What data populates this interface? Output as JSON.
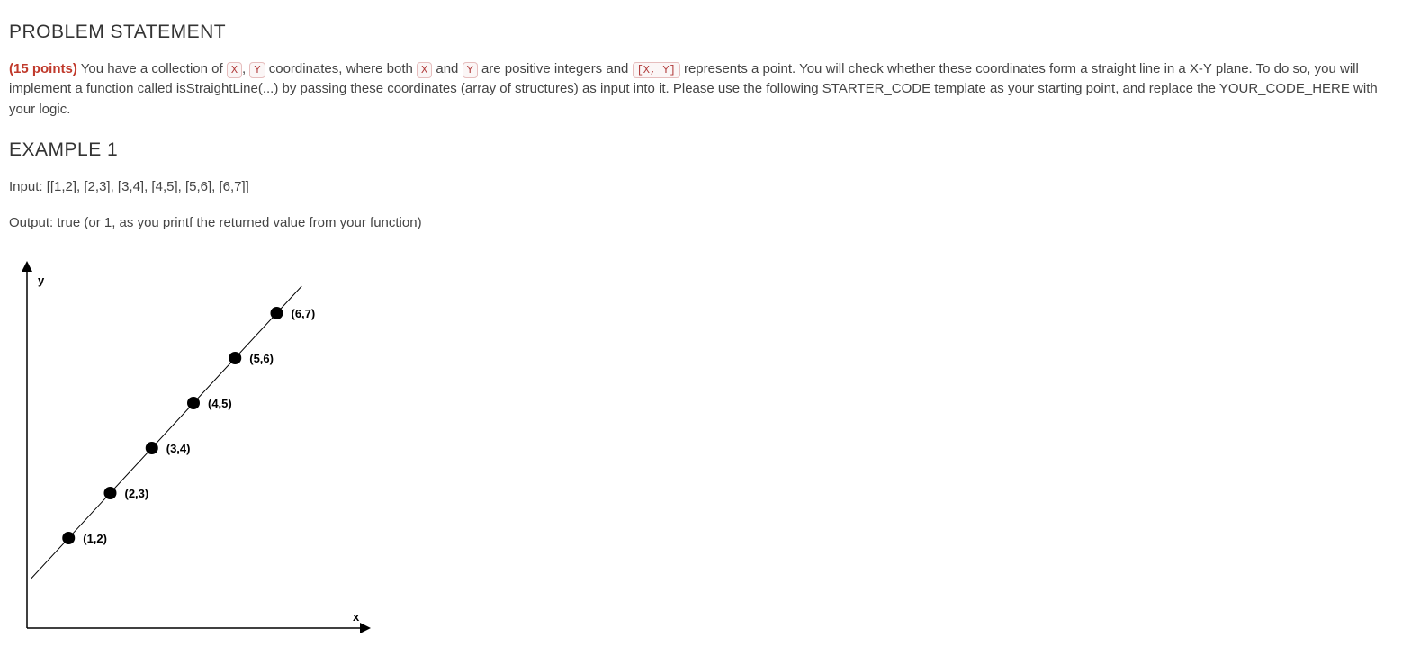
{
  "headings": {
    "problem": "PROBLEM STATEMENT",
    "example1": "EXAMPLE 1"
  },
  "problem": {
    "points_label": "(15 points)",
    "seg1": " You have a collection of ",
    "tok_x": "X",
    "seg2": ", ",
    "tok_y": "Y",
    "seg3": " coordinates, where both ",
    "tok_x2": "X",
    "seg4": " and ",
    "tok_y2": "Y",
    "seg5": " are positive integers and ",
    "tok_xy": "[X, Y]",
    "seg6": " represents a point. You will check whether these coordinates form a straight line in a X-Y plane. To do so, you will implement a function called isStraightLine(...) by passing these coordinates (array of structures) as input into it. Please use the following STARTER_CODE template as your starting point, and replace the YOUR_CODE_HERE with your logic."
  },
  "example1": {
    "input": "Input: [[1,2], [2,3], [3,4], [4,5], [5,6], [6,7]]",
    "output": "Output: true (or 1, as you printf the returned value from your function)"
  },
  "chart_data": {
    "type": "scatter",
    "title": "",
    "xlabel": "x",
    "ylabel": "y",
    "xlim": [
      0,
      8
    ],
    "ylim": [
      0,
      8
    ],
    "series": [
      {
        "name": "points",
        "values": [
          {
            "x": 1,
            "y": 2,
            "label": "(1,2)"
          },
          {
            "x": 2,
            "y": 3,
            "label": "(2,3)"
          },
          {
            "x": 3,
            "y": 4,
            "label": "(3,4)"
          },
          {
            "x": 4,
            "y": 5,
            "label": "(4,5)"
          },
          {
            "x": 5,
            "y": 6,
            "label": "(5,6)"
          },
          {
            "x": 6,
            "y": 7,
            "label": "(6,7)"
          }
        ]
      }
    ],
    "trendline": true
  }
}
